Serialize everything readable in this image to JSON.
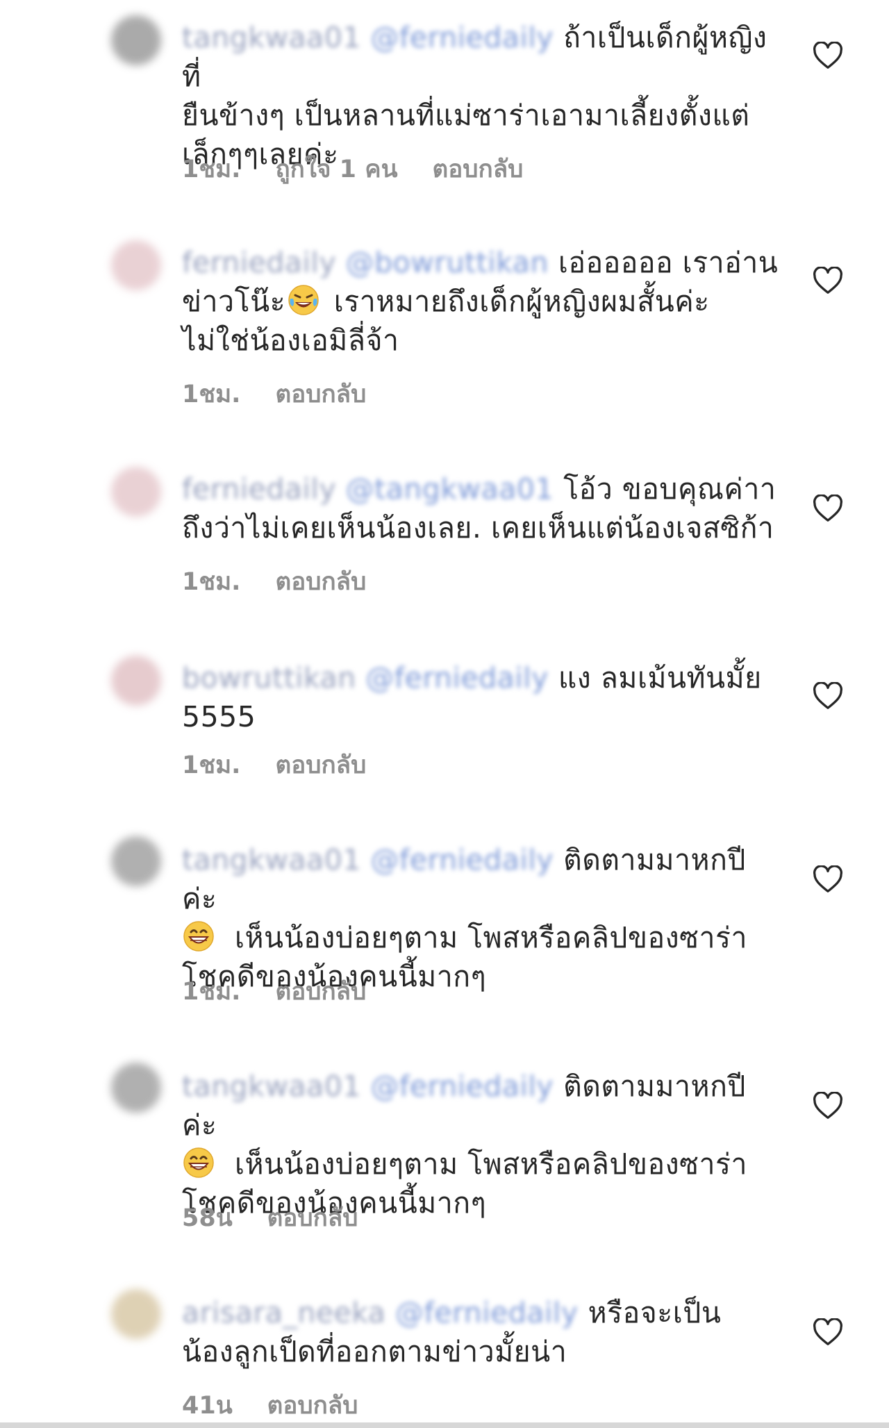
{
  "comments": [
    {
      "user": "tangkwaa01",
      "mention": "@ferniedaily",
      "text": "ถ้าเป็นเด็กผู้หญิงที่\nยืนข้างๆ เป็นหลานที่แม่ซาร่าเอามาเลี้ยงตั้งแต่\nเล็กๆๆเลยค่ะ",
      "time": "1ชม.",
      "likes": "ถูกใจ 1 คน",
      "reply": "ตอบกลับ",
      "avatar_color": "#9c9c9c"
    },
    {
      "user": "ferniedaily",
      "mention": "@bowruttikan",
      "text_a": "เอ่อออออ เราอ่าน\nข่าวโน๊ะ",
      "text_b": " เราหมายถึงเด็กผู้หญิงผมสั้นค่ะ\nไม่ใช่น้องเอมิลี่จ้า",
      "emoji": "laughing-tears-emoji",
      "time": "1ชม.",
      "reply": "ตอบกลับ",
      "avatar_color": "#e6c9cd"
    },
    {
      "user": "ferniedaily",
      "mention": "@tangkwaa01",
      "text": "โอ้ว ขอบคุณค่าา\nถึงว่าไม่เคยเห็นน้องเลย. เคยเห็นแต่น้องเจสซิก้า",
      "time": "1ชม.",
      "reply": "ตอบกลับ",
      "avatar_color": "#e6c9cd"
    },
    {
      "user": "bowruttikan",
      "mention": "@ferniedaily",
      "text": "แง ลมเม้นทันมั้ย\n5555",
      "time": "1ชม.",
      "reply": "ตอบกลับ",
      "avatar_color": "#e2c2c6"
    },
    {
      "user": "tangkwaa01",
      "mention": "@ferniedaily",
      "text_a": "ติดตามมาหกปีค่ะ\n",
      "text_b": "เห็นน้องบ่อยๆตาม โพสหรือคลิปของซาร่า\nโชคดีของน้องคนนี้มากๆ",
      "emoji": "grinning-emoji",
      "time": "1ชม.",
      "reply": "ตอบกลับ",
      "avatar_color": "#a3a3a3"
    },
    {
      "user": "tangkwaa01",
      "mention": "@ferniedaily",
      "text_a": "ติดตามมาหกปีค่ะ\n",
      "text_b": "เห็นน้องบ่อยๆตาม โพสหรือคลิปของซาร่า\nโชคดีของน้องคนนี้มากๆ",
      "emoji": "grinning-emoji",
      "time": "58น",
      "reply": "ตอบกลับ",
      "avatar_color": "#a3a3a3"
    },
    {
      "user": "arisara_neeka",
      "mention": "@ferniedaily",
      "text": "หรือจะเป็น\nน้องลูกเป็ดที่ออกตามข่าวมั้ยน่า",
      "time": "41น",
      "reply": "ตอบกลับ",
      "avatar_color": "#d9c9a8"
    }
  ]
}
